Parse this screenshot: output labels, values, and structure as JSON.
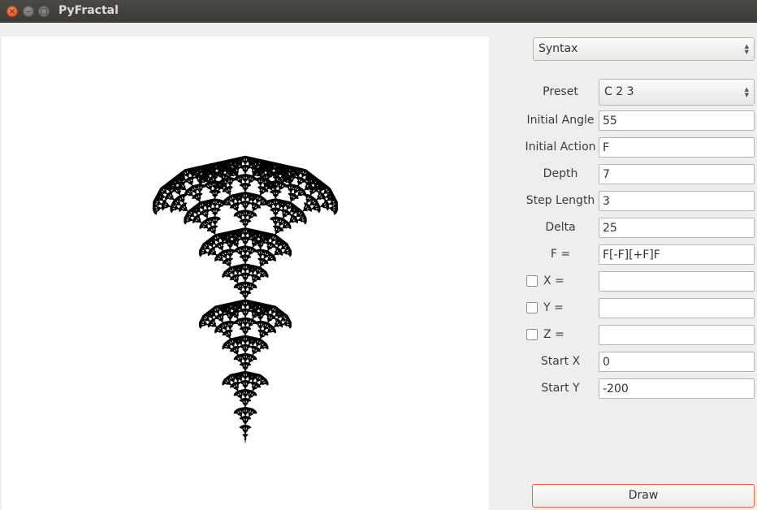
{
  "window": {
    "title": "PyFractal",
    "close_glyph": "×",
    "minimize_glyph": "–",
    "maximize_glyph": "□"
  },
  "mode_combo": {
    "value": "Syntax"
  },
  "form": {
    "preset": {
      "label": "Preset",
      "value": "C 2 3"
    },
    "initial_angle": {
      "label": "Initial Angle",
      "value": "55"
    },
    "initial_action": {
      "label": "Initial Action",
      "value": "F"
    },
    "depth": {
      "label": "Depth",
      "value": "7"
    },
    "step_length": {
      "label": "Step Length",
      "value": "3"
    },
    "delta": {
      "label": "Delta",
      "value": "25"
    },
    "rule_f": {
      "label": "F =",
      "value": "F[-F][+F]F"
    },
    "rule_x": {
      "label": "X =",
      "value": "",
      "checked": false
    },
    "rule_y": {
      "label": "Y =",
      "value": "",
      "checked": false
    },
    "rule_z": {
      "label": "Z =",
      "value": "",
      "checked": false
    },
    "start_x": {
      "label": "Start X",
      "value": "0"
    },
    "start_y": {
      "label": "Start Y",
      "value": "-200"
    }
  },
  "draw_button": {
    "label": "Draw"
  },
  "colors": {
    "accent": "#e0673a",
    "titlebar": "#3c3b37",
    "fractal": "#000000"
  },
  "icons": {
    "combo_arrows": "up-down-arrows-icon",
    "close": "close-icon"
  }
}
